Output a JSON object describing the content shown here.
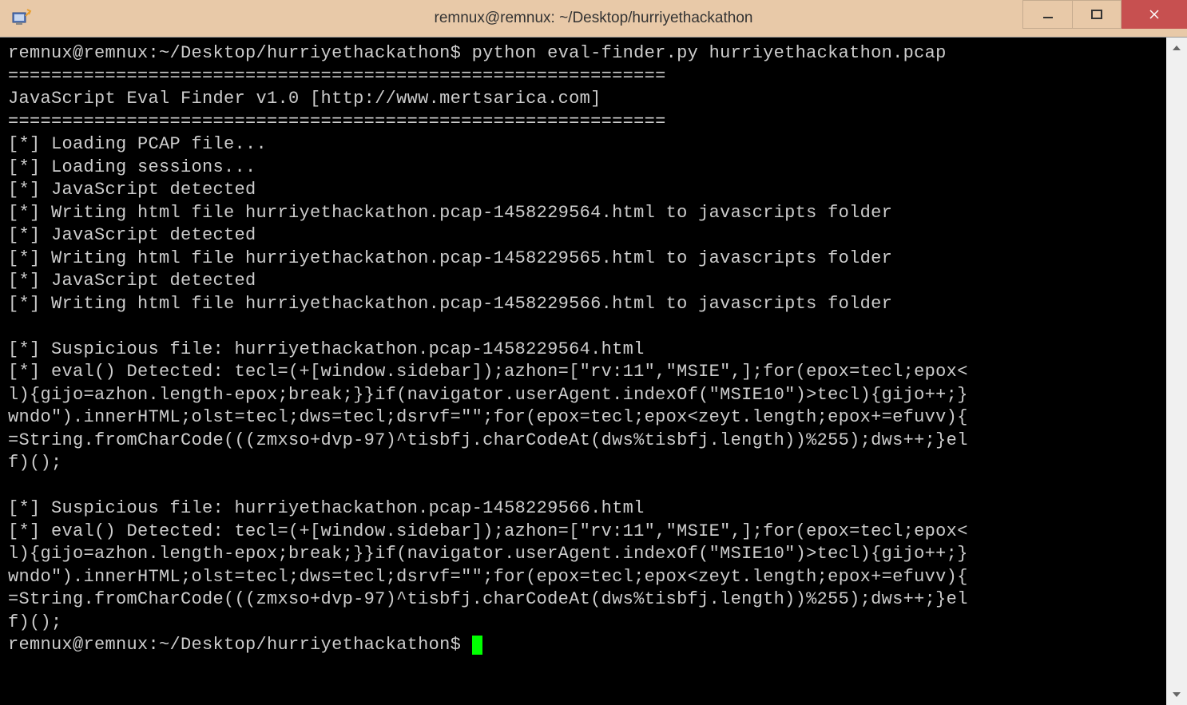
{
  "window": {
    "title": "remnux@remnux: ~/Desktop/hurriyethackathon"
  },
  "terminal": {
    "prompt1": "remnux@remnux:~/Desktop/hurriyethackathon$ python eval-finder.py hurriyethackathon.pcap",
    "sep1": "=============================================================",
    "banner": "JavaScript Eval Finder v1.0 [http://www.mertsarica.com]",
    "sep2": "=============================================================",
    "l1": "[*] Loading PCAP file...",
    "l2": "[*] Loading sessions...",
    "l3": "[*] JavaScript detected",
    "l4": "[*] Writing html file hurriyethackathon.pcap-1458229564.html to javascripts folder",
    "l5": "[*] JavaScript detected",
    "l6": "[*] Writing html file hurriyethackathon.pcap-1458229565.html to javascripts folder",
    "l7": "[*] JavaScript detected",
    "l8": "[*] Writing html file hurriyethackathon.pcap-1458229566.html to javascripts folder",
    "blank1": "",
    "s1_l1": "[*] Suspicious file: hurriyethackathon.pcap-1458229564.html",
    "s1_l2": "[*] eval() Detected: tecl=(+[window.sidebar]);azhon=[\"rv:11\",\"MSIE\",];for(epox=tecl;epox<",
    "s1_l3": "l){gijo=azhon.length-epox;break;}}if(navigator.userAgent.indexOf(\"MSIE10\")>tecl){gijo++;}",
    "s1_l4": "wndo\").innerHTML;olst=tecl;dws=tecl;dsrvf=\"\";for(epox=tecl;epox<zeyt.length;epox+=efuvv){",
    "s1_l5": "=String.fromCharCode(((zmxso+dvp-97)^tisbfj.charCodeAt(dws%tisbfj.length))%255);dws++;}el",
    "s1_l6": "f)();",
    "blank2": "",
    "s2_l1": "[*] Suspicious file: hurriyethackathon.pcap-1458229566.html",
    "s2_l2": "[*] eval() Detected: tecl=(+[window.sidebar]);azhon=[\"rv:11\",\"MSIE\",];for(epox=tecl;epox<",
    "s2_l3": "l){gijo=azhon.length-epox;break;}}if(navigator.userAgent.indexOf(\"MSIE10\")>tecl){gijo++;}",
    "s2_l4": "wndo\").innerHTML;olst=tecl;dws=tecl;dsrvf=\"\";for(epox=tecl;epox<zeyt.length;epox+=efuvv){",
    "s2_l5": "=String.fromCharCode(((zmxso+dvp-97)^tisbfj.charCodeAt(dws%tisbfj.length))%255);dws++;}el",
    "s2_l6": "f)();",
    "prompt2": "remnux@remnux:~/Desktop/hurriyethackathon$ "
  }
}
